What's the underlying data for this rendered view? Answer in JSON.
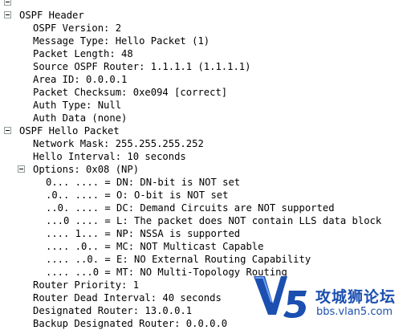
{
  "tree": [
    {
      "text": "",
      "depth": 0,
      "toggle": true
    },
    {
      "text": "OSPF Header",
      "depth": 0,
      "toggle": true
    },
    {
      "text": "OSPF Version: 2",
      "depth": 1
    },
    {
      "text": "Message Type: Hello Packet (1)",
      "depth": 1
    },
    {
      "text": "Packet Length: 48",
      "depth": 1
    },
    {
      "text": "Source OSPF Router: 1.1.1.1 (1.1.1.1)",
      "depth": 1
    },
    {
      "text": "Area ID: 0.0.0.1",
      "depth": 1
    },
    {
      "text": "Packet Checksum: 0xe094 [correct]",
      "depth": 1
    },
    {
      "text": "Auth Type: Null",
      "depth": 1
    },
    {
      "text": "Auth Data (none)",
      "depth": 1
    },
    {
      "text": "OSPF Hello Packet",
      "depth": 0,
      "toggle": true
    },
    {
      "text": "Network Mask: 255.255.255.252",
      "depth": 1
    },
    {
      "text": "Hello Interval: 10 seconds",
      "depth": 1
    },
    {
      "text": "Options: 0x08 (NP)",
      "depth": 1,
      "toggle": true
    },
    {
      "text": "0... .... = DN: DN-bit is NOT set",
      "depth": 2
    },
    {
      "text": ".0.. .... = O: O-bit is NOT set",
      "depth": 2
    },
    {
      "text": "..0. .... = DC: Demand Circuits are NOT supported",
      "depth": 2
    },
    {
      "text": "...0 .... = L: The packet does NOT contain LLS data block",
      "depth": 2
    },
    {
      "text": ".... 1... = NP: NSSA is supported",
      "depth": 2
    },
    {
      "text": ".... .0.. = MC: NOT Multicast Capable",
      "depth": 2
    },
    {
      "text": ".... ..0. = E: NO External Routing Capability",
      "depth": 2
    },
    {
      "text": ".... ...0 = MT: NO Multi-Topology Routing",
      "depth": 2
    },
    {
      "text": "Router Priority: 1",
      "depth": 1
    },
    {
      "text": "Router Dead Interval: 40 seconds",
      "depth": 1
    },
    {
      "text": "Designated Router: 13.0.0.1",
      "depth": 1
    },
    {
      "text": "Backup Designated Router: 0.0.0.0",
      "depth": 1
    }
  ],
  "watermark": {
    "logo_letters": "V5",
    "title": "攻城狮论坛",
    "url": "bbs.vlan5.com"
  }
}
